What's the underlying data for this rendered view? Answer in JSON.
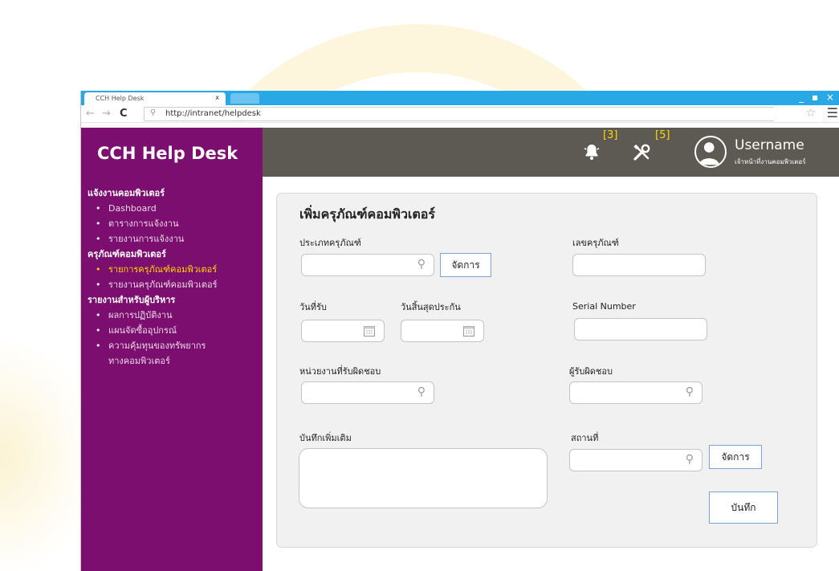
{
  "browser": {
    "tab_title": "CCH Help Desk",
    "tab_close": "x",
    "window_controls": "_ ▪ ×",
    "url": "http://intranet/helpdesk",
    "back_icon": "←",
    "forward_icon": "→",
    "reload_icon": "C",
    "search_icon": "⚲",
    "star_icon": "☆",
    "menu_icon": "☰"
  },
  "app": {
    "brand": "CCH Help Desk",
    "header": {
      "notifications_count": "[3]",
      "tools_count": "[5]",
      "username": "Username",
      "role": "เจ้าหน้าที่งานคอมพิวเตอร์"
    },
    "sidebar": {
      "sections": [
        {
          "title": "แจ้งงานคอมพิวเตอร์",
          "items": [
            "Dashboard",
            "ตารางการแจ้งงาน",
            "รายงานการแจ้งงาน"
          ]
        },
        {
          "title": "ครุภัณฑ์คอมพิวเตอร์",
          "items": [
            "รายการครุภัณฑ์คอมพิวเตอร์",
            "รายงานครุภัณฑ์คอมพิวเตอร์"
          ]
        },
        {
          "title": "รายงานสำหรับผู้บริหาร",
          "items": [
            "ผลการปฏิบัติงาน",
            "แผนจัดซื้ออุปกรณ์",
            "ความคุ้มทุนของทรัพยากร",
            "ทางคอมพิวเตอร์"
          ]
        }
      ],
      "bullet": "•"
    },
    "form": {
      "title": "เพิ่มครุภัณฑ์คอมพิวเตอร์",
      "equipment_type_label": "ประเภทครุภัณฑ์",
      "manage_label": "จัดการ",
      "equipment_number_label": "เลขครุภัณฑ์",
      "received_date_label": "วันที่รับ",
      "warranty_end_label": "วันสิ้นสุดประกัน",
      "serial_number_label": "Serial Number",
      "department_label": "หน่วยงานที่รับผิดชอบ",
      "responsible_label": "ผู้รับผิดชอบ",
      "notes_label": "บันทึกเพิ่มเติม",
      "location_label": "สถานที่",
      "location_manage_label": "จัดการ",
      "save_label": "บันทึก",
      "search_icon": "⚲"
    }
  }
}
